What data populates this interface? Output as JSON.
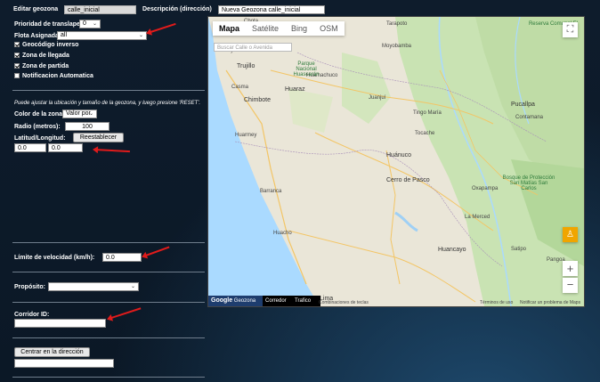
{
  "form": {
    "edit_geozone_label": "Editar geozona",
    "edit_geozone_value": "calle_inicial",
    "description_label": "Descripción (dirección)",
    "description_value": "Nueva Geozona calle_inicial",
    "priority_label": "Prioridad de translape:",
    "priority_value": "0",
    "fleet_label": "Flota Asignada",
    "fleet_value": "all",
    "geocode_reverse_label": "Geocódigo inverso",
    "arrival_zone_label": "Zona de llegada",
    "departure_zone_label": "Zona de partida",
    "auto_notify_label": "Notificacion Automatica",
    "hint_text": "Puede ajustar la ubicación y tamaño de la geozona, y luego presione 'RESET'.",
    "zone_color_label": "Color de la zona:",
    "zone_color_value": "Valor por",
    "radius_label": "Radio (metros):",
    "radius_value": "100",
    "latlon_label": "Latitud/Longitud:",
    "reset_button": "Reestablecer",
    "lat_value": "0.0",
    "lon_value": "0.0",
    "speed_label": "Límite de velocidad (km/h):",
    "speed_value": "0.0",
    "purpose_label": "Propósito:",
    "purpose_value": "",
    "corridor_label": "Corridor ID:",
    "corridor_value": "",
    "center_button": "Centrar en la dirección",
    "center_value": ""
  },
  "map": {
    "tabs": [
      "Mapa",
      "Satélite",
      "Bing",
      "OSM"
    ],
    "search_placeholder": "Buscar Calle o Avenida",
    "places": [
      "Cajamarca",
      "Chota",
      "Trujillo",
      "Huamachuco",
      "Parque Nacional Huascarán",
      "Huaraz",
      "Chimbote",
      "Casma",
      "Huarmey",
      "Barranca",
      "Huacho",
      "Huánuco",
      "Cerro de Pasco",
      "Tingo María",
      "La Merced",
      "Huancayo",
      "Lima",
      "Tarapoto",
      "Moyobamba",
      "Juanjuí",
      "Tocache",
      "Pucallpa",
      "Contamana",
      "Oxapampa",
      "Bosque de Protección San Matías San Carlos",
      "Reserva Comunal El Sira",
      "Satipo",
      "Pangoa"
    ],
    "footer_geozona": "Geozona",
    "footer_corredor": "Corredor",
    "footer_trafico": "Trafico",
    "footer_keys": "Combinaciones de teclas",
    "footer_terms": "Términos de uso",
    "footer_report": "Notificar un problema de Maps",
    "logo_text": "Google",
    "colors": {
      "google_blue": "#4285f4",
      "google_red": "#ea4335",
      "google_yellow": "#fbbc05",
      "google_green": "#34a853"
    }
  },
  "arrow_color": "#e01b1b"
}
